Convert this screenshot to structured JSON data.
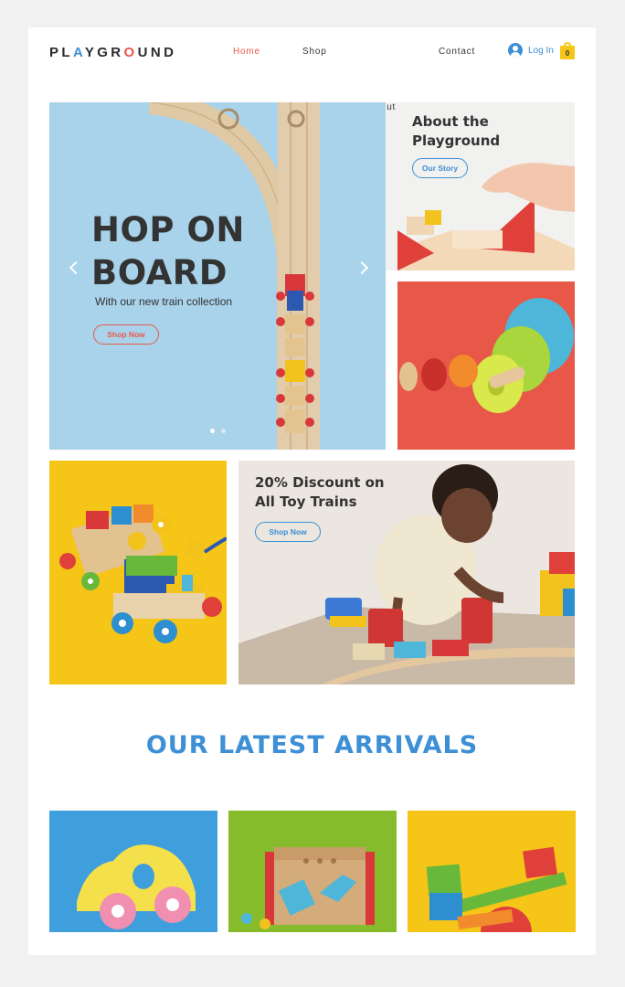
{
  "brand": {
    "logo_parts": [
      "PL",
      "A",
      "YGR",
      "O",
      "UND"
    ]
  },
  "nav": {
    "home": "Home",
    "shop": "Shop",
    "about": "About",
    "contact": "Contact",
    "login": "Log In",
    "cart_count": "0"
  },
  "hero": {
    "title_line1": "HOP ON",
    "title_line2": "BOARD",
    "subtitle": "With our new train collection",
    "button": "Shop Now"
  },
  "about_tile": {
    "title": "About the\nPlayground",
    "button": "Our Story"
  },
  "discount_tile": {
    "title": "20% Discount on\nAll Toy Trains",
    "button": "Shop Now"
  },
  "arrivals": {
    "title": "OUR LATEST ARRIVALS"
  },
  "colors": {
    "accent_red": "#e85849",
    "accent_blue": "#3d8fd6",
    "accent_yellow": "#f5c518",
    "hero_bg": "#a9d3ea"
  }
}
